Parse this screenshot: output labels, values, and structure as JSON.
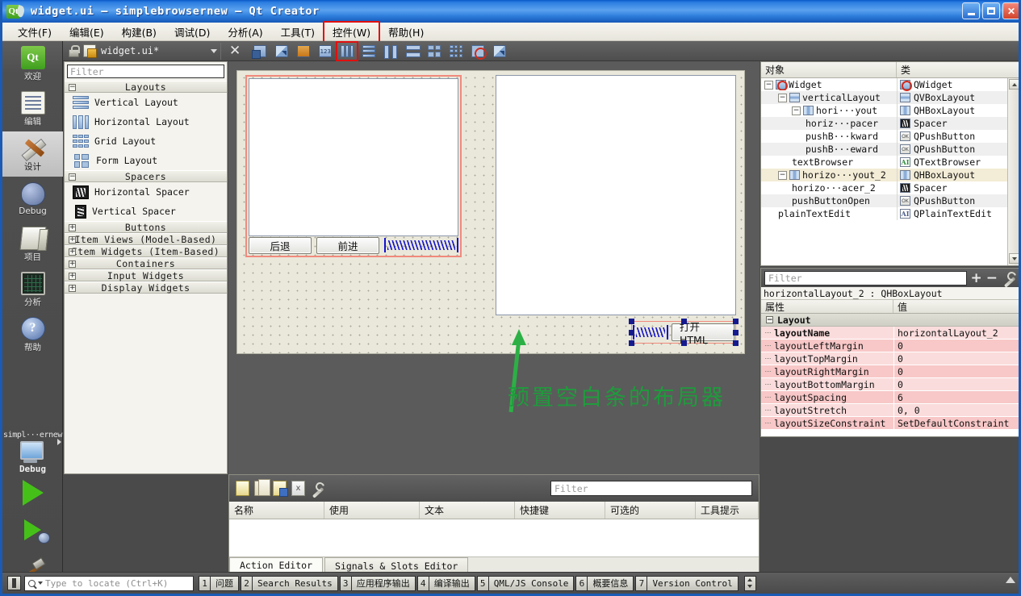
{
  "window": {
    "title": "widget.ui – simplebrowsernew – Qt Creator",
    "minimize": "_",
    "maximize": "□",
    "close": "✕"
  },
  "menubar": {
    "items": [
      {
        "label": "文件(F)",
        "marked": false
      },
      {
        "label": "编辑(E)",
        "marked": false
      },
      {
        "label": "构建(B)",
        "marked": false
      },
      {
        "label": "调试(D)",
        "marked": false
      },
      {
        "label": "分析(A)",
        "marked": false
      },
      {
        "label": "工具(T)",
        "marked": false
      },
      {
        "label": "控件(W)",
        "marked": true
      },
      {
        "label": "帮助(H)",
        "marked": false
      }
    ]
  },
  "modebar": {
    "items": [
      {
        "label": "欢迎",
        "icon": "qt-logo-icon",
        "active": false
      },
      {
        "label": "编辑",
        "icon": "document-edit-icon",
        "active": false
      },
      {
        "label": "设计",
        "icon": "ruler-pencil-icon",
        "active": true
      },
      {
        "label": "Debug",
        "icon": "bug-icon",
        "active": false
      },
      {
        "label": "项目",
        "icon": "folders-icon",
        "active": false
      },
      {
        "label": "分析",
        "icon": "monitor-graph-icon",
        "active": false
      },
      {
        "label": "帮助",
        "icon": "question-mark-icon",
        "active": false
      }
    ]
  },
  "runbar": {
    "kit_name": "simpl···ernew",
    "kit_mode": "Debug",
    "run_label": "run-button",
    "debug_label": "start-debugging-button",
    "build_label": "build-button"
  },
  "designer_toolbar": {
    "filename": "widget.ui*",
    "close_label": "✕",
    "buttons": [
      {
        "name": "edit-widgets-button",
        "icon": "edit-widgets-icon"
      },
      {
        "name": "edit-signals-slots-button",
        "icon": "signals-slots-icon"
      },
      {
        "name": "edit-buddies-button",
        "icon": "buddies-icon"
      },
      {
        "name": "edit-tab-order-button",
        "icon": "tab-order-icon"
      },
      {
        "name": "layout-horizontally-button",
        "icon": "layout-horizontal-icon",
        "marked": true
      },
      {
        "name": "layout-vertically-button",
        "icon": "layout-vertical-icon"
      },
      {
        "name": "layout-splitter-horizontal-button",
        "icon": "splitter-horizontal-icon"
      },
      {
        "name": "layout-splitter-vertical-button",
        "icon": "splitter-vertical-icon"
      },
      {
        "name": "layout-form-button",
        "icon": "form-layout-icon"
      },
      {
        "name": "layout-grid-button",
        "icon": "grid-layout-icon"
      },
      {
        "name": "break-layout-button",
        "icon": "break-layout-icon"
      },
      {
        "name": "adjust-size-button",
        "icon": "adjust-size-icon"
      }
    ]
  },
  "widgetbox": {
    "filter_placeholder": "Filter",
    "categories": [
      {
        "label": "Layouts",
        "expanded": true,
        "sign": "−",
        "items": [
          {
            "label": "Vertical Layout",
            "icon": "vertical-layout-icon"
          },
          {
            "label": "Horizontal Layout",
            "icon": "horizontal-layout-icon"
          },
          {
            "label": "Grid Layout",
            "icon": "grid-layout-icon"
          },
          {
            "label": "Form Layout",
            "icon": "form-layout-icon"
          }
        ]
      },
      {
        "label": "Spacers",
        "expanded": true,
        "sign": "−",
        "items": [
          {
            "label": "Horizontal Spacer",
            "icon": "horizontal-spacer-icon"
          },
          {
            "label": "Vertical Spacer",
            "icon": "vertical-spacer-icon"
          }
        ]
      },
      {
        "label": "Buttons",
        "expanded": false,
        "sign": "+",
        "items": []
      },
      {
        "label": "Item Views (Model-Based)",
        "expanded": false,
        "sign": "+",
        "items": []
      },
      {
        "label": "Item Widgets (Item-Based)",
        "expanded": false,
        "sign": "+",
        "items": []
      },
      {
        "label": "Containers",
        "expanded": false,
        "sign": "+",
        "items": []
      },
      {
        "label": "Input Widgets",
        "expanded": false,
        "sign": "+",
        "items": []
      },
      {
        "label": "Display Widgets",
        "expanded": false,
        "sign": "+",
        "items": []
      }
    ]
  },
  "form": {
    "back_button": "后退",
    "forward_button": "前进",
    "open_html_button": "打开HTML",
    "annotation": "预置空白条的布局器",
    "annotation_color": "#1f9b3c",
    "selection_color": "#151a8f",
    "layout_highlight_color": "#f08a7d"
  },
  "action_editor": {
    "filter_placeholder": "Filter",
    "toolbar": [
      {
        "name": "new-action-button",
        "icon": "new-document-icon"
      },
      {
        "name": "copy-action-button",
        "icon": "copy-documents-icon"
      },
      {
        "name": "paste-action-button",
        "icon": "paste-document-icon"
      },
      {
        "name": "delete-action-button",
        "icon": "delete-document-icon"
      },
      {
        "name": "configure-button",
        "icon": "wrench-icon"
      }
    ],
    "columns": [
      "名称",
      "使用",
      "文本",
      "快捷键",
      "可选的",
      "工具提示"
    ],
    "rows": [],
    "tabs": [
      {
        "label": "Action Editor",
        "active": true
      },
      {
        "label": "Signals & Slots Editor",
        "active": false
      }
    ]
  },
  "object_inspector": {
    "columns": [
      "对象",
      "类"
    ],
    "rows": [
      {
        "name": "Widget",
        "class": "QWidget",
        "depth": 0,
        "twisty": "−",
        "icon": "widget-icon",
        "selected": false
      },
      {
        "name": "verticalLayout",
        "class": "QVBoxLayout",
        "depth": 1,
        "twisty": "−",
        "icon": "vbox-layout-icon",
        "selected": false
      },
      {
        "name": "hori···yout",
        "class": "QHBoxLayout",
        "depth": 2,
        "twisty": "−",
        "icon": "hbox-layout-icon",
        "selected": false
      },
      {
        "name": "horiz···pacer",
        "class": "Spacer",
        "depth": 3,
        "twisty": "",
        "icon": "spacer-icon",
        "selected": false
      },
      {
        "name": "pushB···kward",
        "class": "QPushButton",
        "depth": 3,
        "twisty": "",
        "icon": "pushbutton-icon",
        "selected": false
      },
      {
        "name": "pushB···eward",
        "class": "QPushButton",
        "depth": 3,
        "twisty": "",
        "icon": "pushbutton-icon",
        "selected": false
      },
      {
        "name": "textBrowser",
        "class": "QTextBrowser",
        "depth": 2,
        "twisty": "",
        "icon": "textbrowser-icon",
        "selected": false
      },
      {
        "name": "horizo···yout_2",
        "class": "QHBoxLayout",
        "depth": 1,
        "twisty": "−",
        "icon": "hbox-layout-icon",
        "selected": true
      },
      {
        "name": "horizo···acer_2",
        "class": "Spacer",
        "depth": 2,
        "twisty": "",
        "icon": "spacer-icon",
        "selected": false
      },
      {
        "name": "pushButtonOpen",
        "class": "QPushButton",
        "depth": 2,
        "twisty": "",
        "icon": "pushbutton-icon",
        "selected": false
      },
      {
        "name": "plainTextEdit",
        "class": "QPlainTextEdit",
        "depth": 1,
        "twisty": "",
        "icon": "plaintextedit-icon",
        "selected": false
      }
    ]
  },
  "property_editor": {
    "filter_placeholder": "Filter",
    "add_label": "+",
    "remove_label": "−",
    "configure_icon": "wrench-icon",
    "object_line": "horizontalLayout_2 : QHBoxLayout",
    "columns": [
      "属性",
      "值"
    ],
    "group": {
      "label": "Layout",
      "sign": "−"
    },
    "rows": [
      {
        "key": "layoutName",
        "value": "horizontalLayout_2",
        "bold": true
      },
      {
        "key": "layoutLeftMargin",
        "value": "0",
        "bold": false
      },
      {
        "key": "layoutTopMargin",
        "value": "0",
        "bold": false
      },
      {
        "key": "layoutRightMargin",
        "value": "0",
        "bold": false
      },
      {
        "key": "layoutBottomMargin",
        "value": "0",
        "bold": false
      },
      {
        "key": "layoutSpacing",
        "value": "6",
        "bold": false
      },
      {
        "key": "layoutStretch",
        "value": "0, 0",
        "bold": false
      },
      {
        "key": "layoutSizeConstraint",
        "value": "SetDefaultConstraint",
        "bold": false
      }
    ]
  },
  "statusbar": {
    "locate_placeholder": "Type to locate (Ctrl+K)",
    "panes": [
      {
        "num": "1",
        "label": "问题"
      },
      {
        "num": "2",
        "label": "Search Results"
      },
      {
        "num": "3",
        "label": "应用程序输出"
      },
      {
        "num": "4",
        "label": "编译输出"
      },
      {
        "num": "5",
        "label": "QML/JS Console"
      },
      {
        "num": "6",
        "label": "概要信息"
      },
      {
        "num": "7",
        "label": "Version Control"
      }
    ]
  }
}
